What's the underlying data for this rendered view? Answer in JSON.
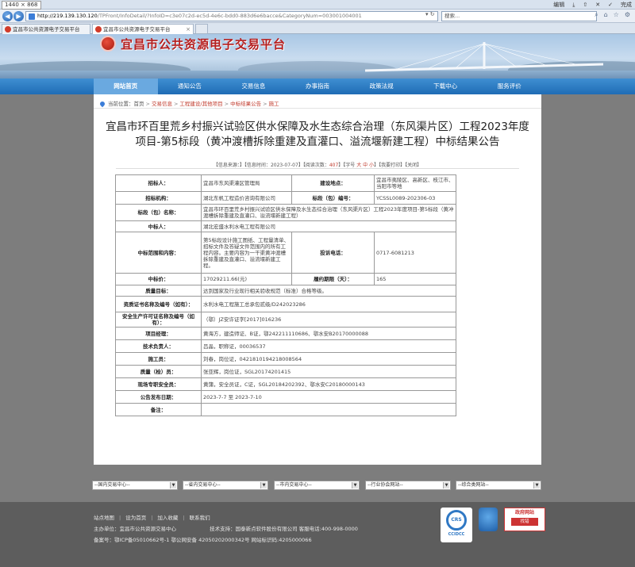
{
  "browser": {
    "dimension_label": "1440 × 868",
    "window_controls": [
      "编辑",
      "完成"
    ],
    "url_host": "http://219.139.130.120",
    "url_rest": "/TPFront/InfoDetail/?InfoID=c3e07c2d-ec5d-4e6c-bdd0-883d6e6bacce&CategoryNum=003001004001",
    "search_placeholder": "搜索...",
    "tabs": [
      {
        "label": "宜昌市公共资源电子交易平台"
      },
      {
        "label": "宜昌市公共资源电子交易平台"
      }
    ]
  },
  "site": {
    "logo_text": "宜昌市公共资源电子交易平台",
    "nav": [
      "网站首页",
      "通知公告",
      "交易信息",
      "办事指南",
      "政策法规",
      "下载中心",
      "服务评价"
    ]
  },
  "breadcrumb": {
    "prefix": "当前位置：",
    "items": [
      "首页",
      "交易信息",
      "工程建设/其他项目",
      "中标结果公告",
      "施工"
    ]
  },
  "document": {
    "title": "宜昌市环百里荒乡村振兴试验区供水保障及水生态综合治理（东风渠片区）工程2023年度项目-第5标段（黄冲渡槽拆除重建及直灌口、溢流堰新建工程）中标结果公告",
    "meta": {
      "source_label": "【信息来源：",
      "source": "",
      "time_label": "】【信息时间：",
      "time": "2023-07-07",
      "views_label": "阅读次数：",
      "views": "407",
      "font_label": "】【字号",
      "font_sizes": "大 中 小",
      "print": "】【我要打印】",
      "close": "【关闭】"
    },
    "table": [
      {
        "l1": "招标人：",
        "v1": "宜昌市东风渠灌区管理局",
        "l2": "建设地点：",
        "v2": "宜昌市夷陵区、高新区、枝江市、当阳市等地"
      },
      {
        "l1": "招标机构：",
        "v1": "湖北东帆工程造价咨询有限公司",
        "l2": "标段（包）编号：",
        "v2": "YCSSL0089-202306-03"
      },
      {
        "l1": "标段（包）名称：",
        "v1": "宜昌市环百里荒乡村振兴试验区供水保障及水生态综合治理（东风渠片区）工程2023年度项目-第5标段（黄冲渡槽拆除重建及直灌口、溢流堰新建工程）"
      },
      {
        "l1": "中标人：",
        "v1": "湖北宏盛水利水电工程有限公司"
      },
      {
        "l1": "中标范围和内容：",
        "v1": "第5标段设计施工图纸、工程量清单、招标文件及答疑文件范围内的所有工程内容。主要内容为一干渠黄冲渡槽拆除重建及直灌口、溢流堰新建工程。",
        "l2": "投诉电话：",
        "v2": "0717-6081213"
      },
      {
        "l1": "中标价：",
        "v1": "17029211.66(元)",
        "l2": "履约期限（天）：",
        "v2": "165"
      },
      {
        "l1": "质量目标：",
        "v1": "达到国家及行业现行相关验收规范（标准）合格等级。"
      },
      {
        "l1": "资质证书名称及编号（如有）：",
        "v1": "水利水电工程施工总承包贰级/D242023286"
      },
      {
        "l1": "安全生产许可证名称及编号（如有）：",
        "v1": "（鄂）JZ安许证字[2017]016236"
      },
      {
        "l1": "项目经理：",
        "v1": "黄海方，建造师证、B证，鄂242211110686、鄂水安B20170000088"
      },
      {
        "l1": "技术负责人：",
        "v1": "吕晶，职称证，00036537"
      },
      {
        "l1": "施工员：",
        "v1": "刘春，岗位证，0421810194218008564"
      },
      {
        "l1": "质量（检）员：",
        "v1": "张亚辉，岗位证，SGL20174201415"
      },
      {
        "l1": "现场专职安全员：",
        "v1": "黄蒲，安全员证，C证，SGL20184202392、鄂水安C20180000143"
      },
      {
        "l1": "公告发布日期：",
        "v1": "2023-7-7  至  2023-7-10"
      },
      {
        "l1": "备注：",
        "v1": ""
      }
    ]
  },
  "footer": {
    "selects": [
      "--国内交易中心--",
      "--省内交易中心--",
      "--市内交易中心--",
      "--行业协会网站--",
      "--综合类网站--"
    ],
    "links": [
      "站点地图",
      "设为首页",
      "加入收藏",
      "联系我们"
    ],
    "host_label": "主办单位：宜昌市公共资源交易中心",
    "tech_label": "技术支持：国泰新点软件股份有限公司 客服电话:400-998-0000",
    "icp": "备案号：鄂ICP备05010662号-1  鄂公网安备 42050202000342号  网站标识码:4205000066",
    "badge_ccidcc": "CCIDCC",
    "badge_ccidcc_ring": "CRS",
    "badge_trust": "",
    "badge_gov_title": "政府网站",
    "badge_gov_sub": "找错"
  }
}
